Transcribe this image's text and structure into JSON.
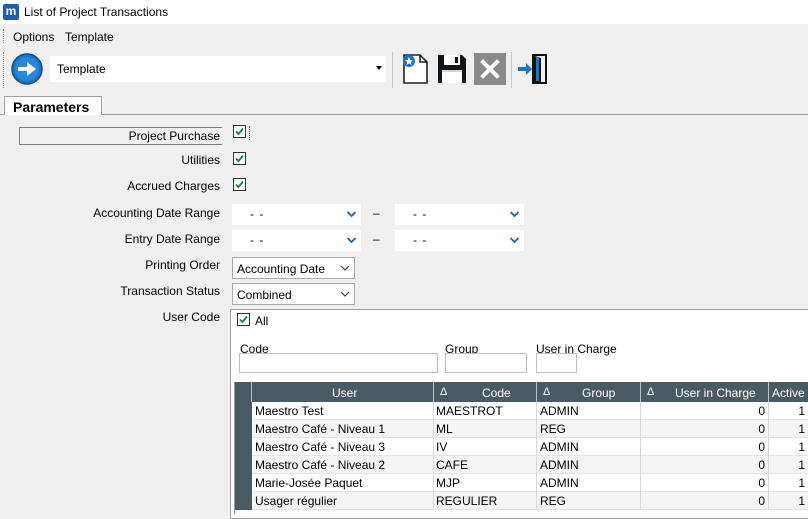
{
  "window": {
    "title": "List of Project Transactions"
  },
  "menu": {
    "options": "Options",
    "template": "Template"
  },
  "toolbar": {
    "template_value": "Template"
  },
  "tabs": {
    "parameters": "Parameters"
  },
  "params": {
    "project_purchase": "Project Purchase",
    "utilities": "Utilities",
    "accrued_charges": "Accrued Charges",
    "accounting_date_range": "Accounting Date Range",
    "entry_date_range": "Entry Date Range",
    "printing_order": "Printing Order",
    "printing_order_value": "Accounting Date",
    "transaction_status": "Transaction Status",
    "transaction_status_value": "Combined",
    "user_code": "User Code",
    "date_placeholder": "- -",
    "range_dash": "–"
  },
  "user_filter": {
    "all_label": "All",
    "code_label": "Code",
    "group_label": "Group",
    "user_in_charge_label": "User in Charge"
  },
  "grid": {
    "headers": {
      "user": "User",
      "code": "Code",
      "group": "Group",
      "user_in_charge": "User in Charge",
      "active": "Active",
      "delta": "Δ"
    },
    "rows": [
      {
        "user": "Maestro Test",
        "code": "MAESTROT",
        "group": "ADMIN",
        "uic": "0",
        "active": "1"
      },
      {
        "user": "Maestro Café - Niveau 1",
        "code": "ML",
        "group": "REG",
        "uic": "0",
        "active": "1"
      },
      {
        "user": "Maestro Café - Niveau 3",
        "code": "IV",
        "group": "ADMIN",
        "uic": "0",
        "active": "1"
      },
      {
        "user": "Maestro Café - Niveau 2",
        "code": "CAFE",
        "group": "ADMIN",
        "uic": "0",
        "active": "1"
      },
      {
        "user": "Marie-Josée Paquet",
        "code": "MJP",
        "group": "ADMIN",
        "uic": "0",
        "active": "1"
      },
      {
        "user": "Usager régulier",
        "code": "REGULIER",
        "group": "REG",
        "uic": "0",
        "active": "1"
      }
    ]
  }
}
